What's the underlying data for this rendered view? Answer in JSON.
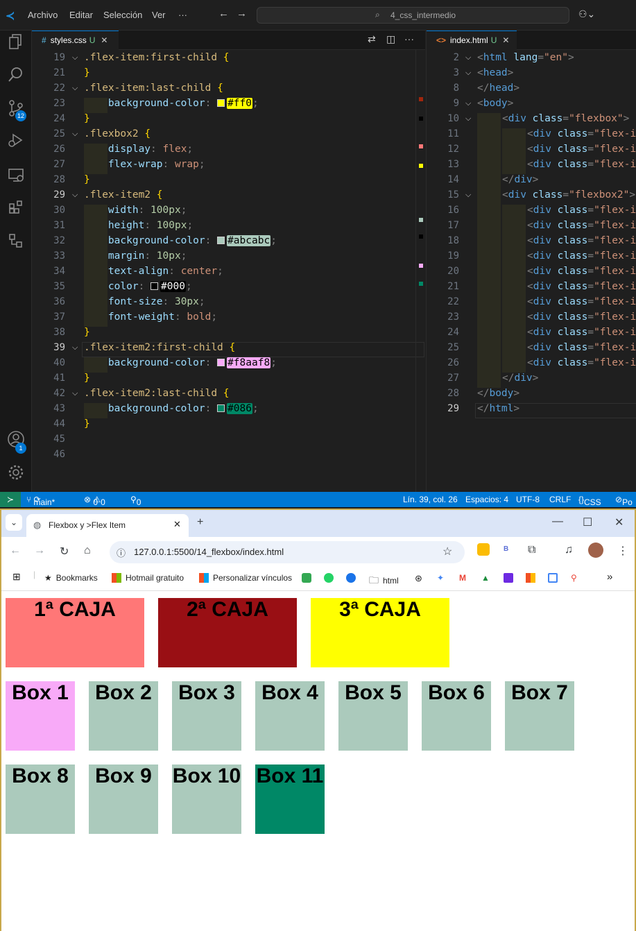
{
  "vscode": {
    "menu": [
      "Archivo",
      "Editar",
      "Selección",
      "Ver",
      "···"
    ],
    "command_center": "4_css_intermedio",
    "activity": {
      "source_control_badge": "12",
      "accounts_badge": "1"
    },
    "editor_left": {
      "tab": {
        "name": "styles.css",
        "status": "U"
      },
      "lines": [
        {
          "n": "19",
          "text": ".flex-item:first-child {"
        },
        {
          "n": "21",
          "text": "}"
        },
        {
          "n": "22",
          "text": ".flex-item:last-child {"
        },
        {
          "n": "23",
          "prop": "background-color",
          "value": "#ff0",
          "swatch": "#ffff00"
        },
        {
          "n": "24",
          "text": "}"
        },
        {
          "n": "25",
          "text": ".flexbox2 {"
        },
        {
          "n": "26",
          "prop": "display",
          "value": "flex"
        },
        {
          "n": "27",
          "prop": "flex-wrap",
          "value": "wrap"
        },
        {
          "n": "28",
          "text": "}"
        },
        {
          "n": "29",
          "text": ".flex-item2 {"
        },
        {
          "n": "30",
          "prop": "width",
          "value": "100px"
        },
        {
          "n": "31",
          "prop": "height",
          "value": "100px"
        },
        {
          "n": "32",
          "prop": "background-color",
          "value": "#abcabc",
          "swatch": "#abcabc"
        },
        {
          "n": "33",
          "prop": "margin",
          "value": "10px"
        },
        {
          "n": "34",
          "prop": "text-align",
          "value": "center"
        },
        {
          "n": "35",
          "prop": "color",
          "value": "#000",
          "swatch": "#000000"
        },
        {
          "n": "36",
          "prop": "font-size",
          "value": "30px"
        },
        {
          "n": "37",
          "prop": "font-weight",
          "value": "bold"
        },
        {
          "n": "38",
          "text": "}"
        },
        {
          "n": "39",
          "text": ".flex-item2:first-child {"
        },
        {
          "n": "40",
          "prop": "background-color",
          "value": "#f8aaf8",
          "swatch": "#f8aaf8"
        },
        {
          "n": "41",
          "text": "}"
        },
        {
          "n": "42",
          "text": ".flex-item2:last-child {"
        },
        {
          "n": "43",
          "prop": "background-color",
          "value": "#086",
          "swatch": "#008866"
        },
        {
          "n": "44",
          "text": "}"
        },
        {
          "n": "45",
          "text": ""
        },
        {
          "n": "46",
          "text": ""
        }
      ]
    },
    "editor_right": {
      "tab": {
        "name": "index.html",
        "status": "U"
      },
      "lines": [
        {
          "n": "2",
          "text": "<html lang=\"en\">"
        },
        {
          "n": "3",
          "text": "<head>"
        },
        {
          "n": "8",
          "text": "</head>"
        },
        {
          "n": "9",
          "text": "<body>"
        },
        {
          "n": "10",
          "text": "<div class=\"flexbox\">"
        },
        {
          "n": "11",
          "text": "<div class=\"flex-it"
        },
        {
          "n": "12",
          "text": "<div class=\"flex-it"
        },
        {
          "n": "13",
          "text": "<div class=\"flex-it"
        },
        {
          "n": "14",
          "text": "</div>"
        },
        {
          "n": "15",
          "text": "<div class=\"flexbox2\">"
        },
        {
          "n": "16",
          "text": "<div class=\"flex-it"
        },
        {
          "n": "17",
          "text": "<div class=\"flex-it"
        },
        {
          "n": "18",
          "text": "<div class=\"flex-it"
        },
        {
          "n": "19",
          "text": "<div class=\"flex-it"
        },
        {
          "n": "20",
          "text": "<div class=\"flex-it"
        },
        {
          "n": "21",
          "text": "<div class=\"flex-it"
        },
        {
          "n": "22",
          "text": "<div class=\"flex-it"
        },
        {
          "n": "23",
          "text": "<div class=\"flex-it"
        },
        {
          "n": "24",
          "text": "<div class=\"flex-it"
        },
        {
          "n": "25",
          "text": "<div class=\"flex-it"
        },
        {
          "n": "26",
          "text": "<div class=\"flex-it"
        },
        {
          "n": "27",
          "text": "</div>"
        },
        {
          "n": "28",
          "text": "</body>"
        },
        {
          "n": "29",
          "text": "</html>"
        }
      ]
    },
    "statusbar": {
      "branch": "main*",
      "errors": "0",
      "warnings": "0",
      "ports": "0",
      "position": "Lín. 39, col. 26",
      "spaces": "Espacios: 4",
      "encoding": "UTF-8",
      "eol": "CRLF",
      "language": "CSS",
      "extra": "Po"
    }
  },
  "browser": {
    "tab_title": "Flexbox y >Flex Item",
    "url": "127.0.0.1:5500/14_flexbox/index.html",
    "bookmarks": [
      "Bookmarks",
      "Hotmail gratuito",
      "Personalizar vínculos",
      "html"
    ],
    "page": {
      "flexbox_items": [
        {
          "label": "1ª CAJA",
          "color": "#ff7777"
        },
        {
          "label": "2ª CAJA",
          "color": "#990f14"
        },
        {
          "label": "3ª CAJA",
          "color": "#ffff00"
        }
      ],
      "flexbox2_items": [
        {
          "label": "Box 1",
          "color": "#f8aaf8"
        },
        {
          "label": "Box 2",
          "color": "#abcabc"
        },
        {
          "label": "Box 3",
          "color": "#abcabc"
        },
        {
          "label": "Box 4",
          "color": "#abcabc"
        },
        {
          "label": "Box 5",
          "color": "#abcabc"
        },
        {
          "label": "Box 6",
          "color": "#abcabc"
        },
        {
          "label": "Box 7",
          "color": "#abcabc"
        },
        {
          "label": "Box 8",
          "color": "#abcabc"
        },
        {
          "label": "Box 9",
          "color": "#abcabc"
        },
        {
          "label": "Box 10",
          "color": "#abcabc"
        },
        {
          "label": "Box 11",
          "color": "#008866"
        }
      ]
    }
  }
}
